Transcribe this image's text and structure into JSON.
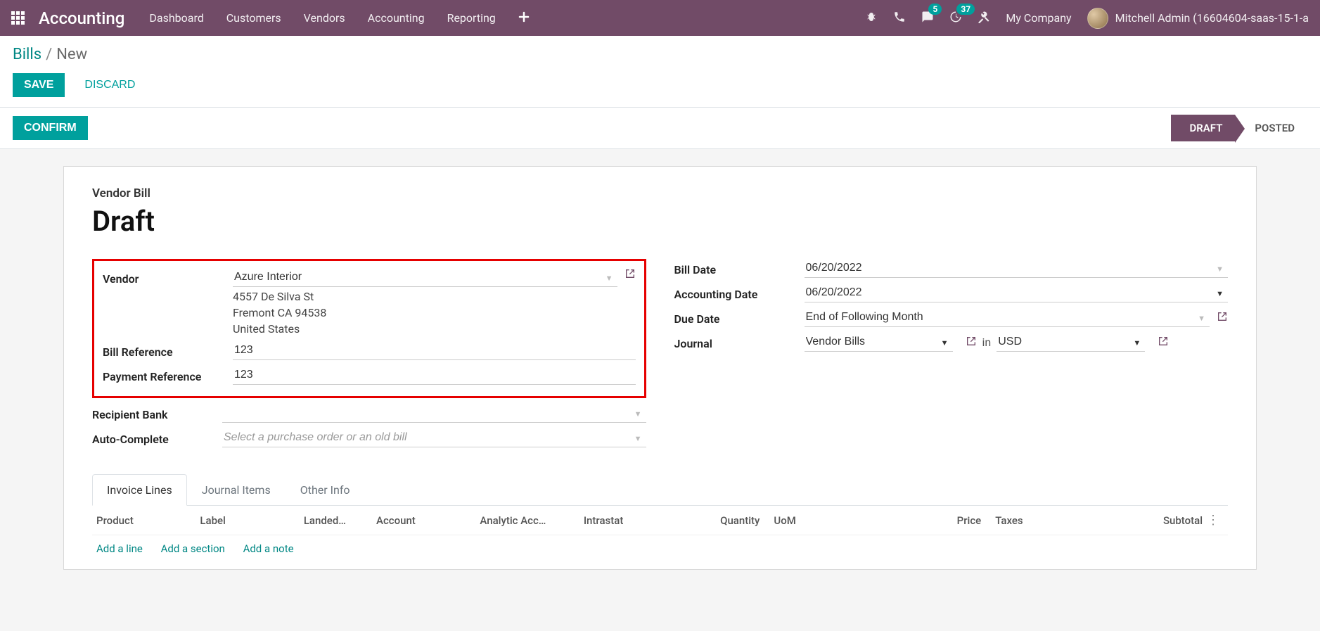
{
  "navbar": {
    "app_title": "Accounting",
    "menu": [
      "Dashboard",
      "Customers",
      "Vendors",
      "Accounting",
      "Reporting"
    ],
    "msg_badge": "5",
    "activity_badge": "37",
    "company": "My Company",
    "user": "Mitchell Admin (16604604-saas-15-1-a"
  },
  "breadcrumbs": {
    "root": "Bills",
    "current": "New"
  },
  "buttons": {
    "save": "SAVE",
    "discard": "DISCARD",
    "confirm": "CONFIRM"
  },
  "status": {
    "draft": "DRAFT",
    "posted": "POSTED"
  },
  "title": {
    "type": "Vendor Bill",
    "name": "Draft"
  },
  "labels": {
    "vendor": "Vendor",
    "bill_ref": "Bill Reference",
    "pay_ref": "Payment Reference",
    "recipient_bank": "Recipient Bank",
    "auto_complete": "Auto-Complete",
    "bill_date": "Bill Date",
    "accounting_date": "Accounting Date",
    "due_date": "Due Date",
    "journal": "Journal",
    "in": "in"
  },
  "vendor": {
    "name": "Azure Interior",
    "street": "4557 De Silva St",
    "city_state_zip": "Fremont CA 94538",
    "country": "United States"
  },
  "values": {
    "bill_ref": "123",
    "pay_ref": "123",
    "recipient_bank": "",
    "auto_complete_placeholder": "Select a purchase order or an old bill",
    "bill_date": "06/20/2022",
    "accounting_date": "06/20/2022",
    "due_date": "End of Following Month",
    "journal": "Vendor Bills",
    "currency": "USD"
  },
  "tabs": [
    "Invoice Lines",
    "Journal Items",
    "Other Info"
  ],
  "grid": {
    "cols": [
      "Product",
      "Label",
      "Landed…",
      "Account",
      "Analytic Acc…",
      "Intrastat",
      "Quantity",
      "UoM",
      "Price",
      "Taxes",
      "Subtotal"
    ],
    "actions": [
      "Add a line",
      "Add a section",
      "Add a note"
    ]
  }
}
